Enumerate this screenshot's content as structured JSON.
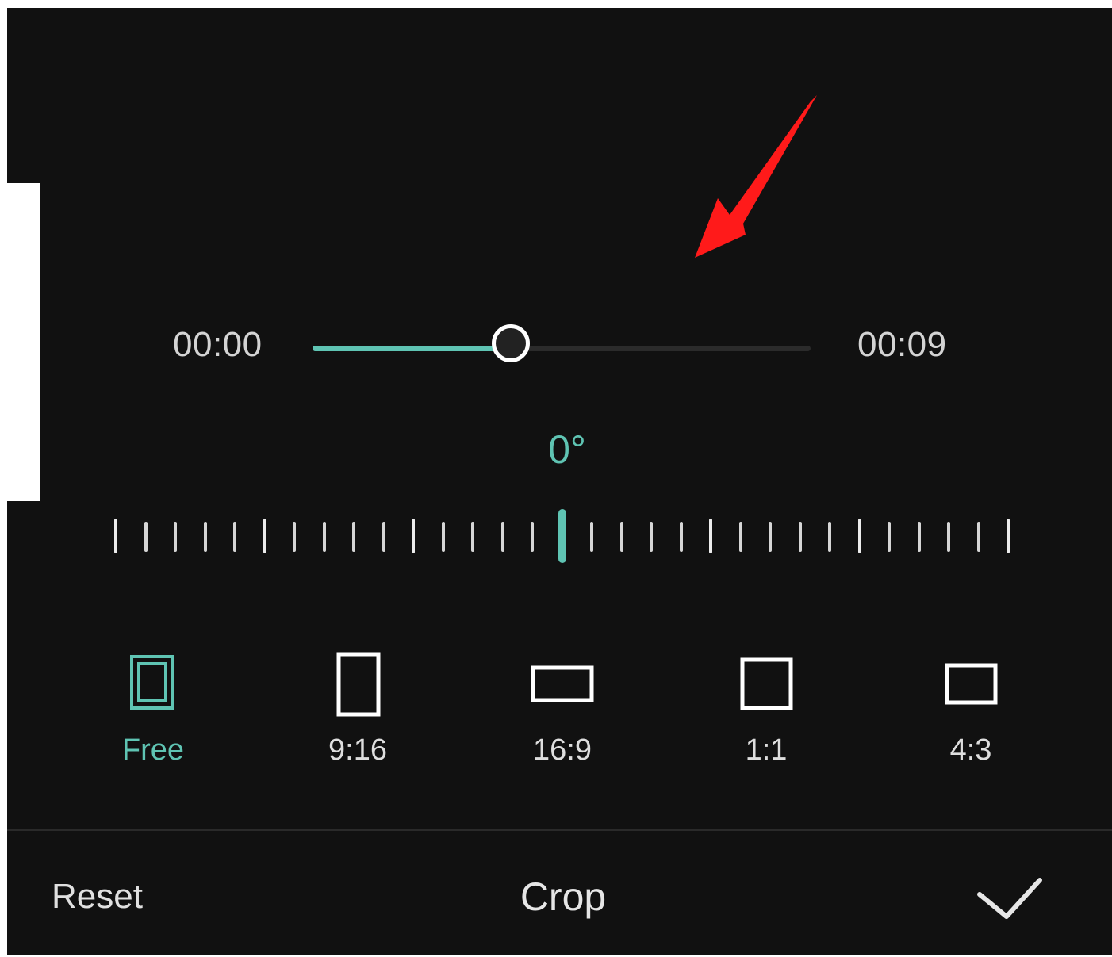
{
  "playback": {
    "start_time": "00:00",
    "end_time": "00:09",
    "progress": 0.4
  },
  "rotation": {
    "angle": "0°"
  },
  "aspect_ratios": [
    {
      "label": "Free",
      "icon": "free-ratio-icon",
      "selected": true
    },
    {
      "label": "9:16",
      "icon": "portrait-ratio-icon",
      "selected": false
    },
    {
      "label": "16:9",
      "icon": "landscape-ratio-icon",
      "selected": false
    },
    {
      "label": "1:1",
      "icon": "square-ratio-icon",
      "selected": false
    },
    {
      "label": "4:3",
      "icon": "four-three-ratio-icon",
      "selected": false
    }
  ],
  "toolbar": {
    "reset_label": "Reset",
    "title": "Crop",
    "confirm_icon": "check-icon"
  },
  "colors": {
    "background": "#111111",
    "accent": "#5fc4b3",
    "annotation_arrow": "#ff1a1a"
  }
}
